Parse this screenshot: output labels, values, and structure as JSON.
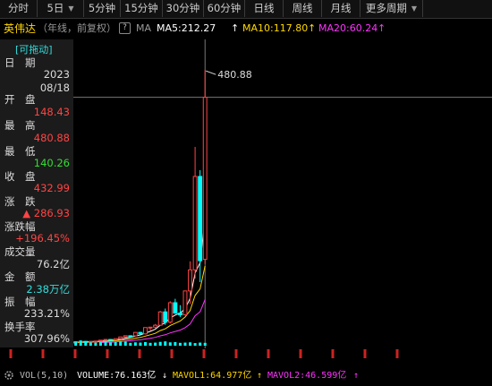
{
  "tabs": [
    {
      "label": "分时",
      "w": 42
    },
    {
      "label": "5日",
      "w": 52,
      "dropdown": true
    },
    {
      "label": "5分钟",
      "w": 41
    },
    {
      "label": "15分钟",
      "w": 47
    },
    {
      "label": "30分钟",
      "w": 46
    },
    {
      "label": "60分钟",
      "w": 46
    },
    {
      "label": "日线",
      "w": 43
    },
    {
      "label": "周线",
      "w": 43
    },
    {
      "label": "月线",
      "w": 43
    },
    {
      "label": "更多周期",
      "w": 70,
      "dropdown": true
    }
  ],
  "header": {
    "stock_name": "英伟达",
    "period_note": "（年线，前复权）",
    "help_icon": "question-icon",
    "ma_label": "MA",
    "ma5": "MA5:212.27",
    "ma10": "MA10:117.80",
    "ma20": "MA20:60.24",
    "up_arrow": "↑",
    "colors": {
      "ma5": "#ffffff",
      "ma10": "#ffd700",
      "ma20": "#ff33ff"
    }
  },
  "info_panel": {
    "drag_label": "[可拖动]",
    "rows": [
      {
        "label": "日　期",
        "value": "2023",
        "value2": "08/18",
        "color": "#dddddd"
      },
      {
        "label": "开　盘",
        "value": "148.43",
        "color": "#ff4444"
      },
      {
        "label": "最　高",
        "value": "480.88",
        "color": "#ff4444"
      },
      {
        "label": "最　低",
        "value": "140.26",
        "color": "#33dd33"
      },
      {
        "label": "收　盘",
        "value": "432.99",
        "color": "#ff4444"
      },
      {
        "label": "涨　跌",
        "value": "▲ 286.93",
        "color": "#ff4444"
      },
      {
        "label": "涨跌幅",
        "value": "+196.45%",
        "color": "#ff4444"
      },
      {
        "label": "成交量",
        "value": "76.2亿",
        "color": "#dddddd"
      },
      {
        "label": "金　额",
        "value": "2.38万亿",
        "color": "#33dddd"
      },
      {
        "label": "振　幅",
        "value": "233.21%",
        "color": "#dddddd"
      },
      {
        "label": "换手率",
        "value": "307.96%",
        "color": "#dddddd"
      }
    ]
  },
  "chart_data": {
    "type": "candlestick",
    "y_range": [
      0,
      500
    ],
    "max_label": "480.88",
    "bullish_color": "#ff4444",
    "bearish_color": "#00ffff",
    "candles": [
      {
        "o": 0.12,
        "h": 0.15,
        "l": 0.08,
        "c": 0.14
      },
      {
        "o": 0.14,
        "h": 0.2,
        "l": 0.12,
        "c": 0.18
      },
      {
        "o": 0.18,
        "h": 0.3,
        "l": 0.16,
        "c": 0.28
      },
      {
        "o": 0.28,
        "h": 0.35,
        "l": 0.2,
        "c": 0.22
      },
      {
        "o": 0.22,
        "h": 0.28,
        "l": 0.18,
        "c": 0.25
      },
      {
        "o": 0.25,
        "h": 0.45,
        "l": 0.24,
        "c": 0.42
      },
      {
        "o": 0.42,
        "h": 0.85,
        "l": 0.4,
        "c": 0.8
      },
      {
        "o": 0.8,
        "h": 1.3,
        "l": 0.75,
        "c": 1.2
      },
      {
        "o": 1.2,
        "h": 1.8,
        "l": 1.1,
        "c": 1.7
      },
      {
        "o": 1.7,
        "h": 2.3,
        "l": 1.6,
        "c": 2.2
      },
      {
        "o": 2.2,
        "h": 2.6,
        "l": 1.9,
        "c": 2.05
      },
      {
        "o": 2.05,
        "h": 2.5,
        "l": 1.8,
        "c": 2.4
      },
      {
        "o": 2.4,
        "h": 2.7,
        "l": 2.1,
        "c": 2.5
      },
      {
        "o": 2.5,
        "h": 3.6,
        "l": 2.4,
        "c": 3.5
      },
      {
        "o": 3.5,
        "h": 4.2,
        "l": 3.2,
        "c": 3.9
      },
      {
        "o": 3.9,
        "h": 4.6,
        "l": 3.7,
        "c": 4.5
      },
      {
        "o": 4.5,
        "h": 4.9,
        "l": 3.9,
        "c": 4.1
      },
      {
        "o": 4.1,
        "h": 4.8,
        "l": 3.6,
        "c": 4.4
      },
      {
        "o": 4.4,
        "h": 5.2,
        "l": 4.2,
        "c": 5.0
      },
      {
        "o": 5.0,
        "h": 6.8,
        "l": 4.8,
        "c": 6.5
      },
      {
        "o": 6.5,
        "h": 8.2,
        "l": 6.2,
        "c": 7.8
      },
      {
        "o": 7.8,
        "h": 8.5,
        "l": 6.3,
        "c": 6.8
      },
      {
        "o": 6.8,
        "h": 9.5,
        "l": 6.6,
        "c": 9.1
      },
      {
        "o": 9.1,
        "h": 12.5,
        "l": 8.9,
        "c": 12.2
      },
      {
        "o": 12.2,
        "h": 14.6,
        "l": 11.6,
        "c": 14.3
      },
      {
        "o": 14.3,
        "h": 15.2,
        "l": 11.5,
        "c": 14.1
      },
      {
        "o": 14.1,
        "h": 20.6,
        "l": 13.9,
        "c": 20.2
      },
      {
        "o": 20.2,
        "h": 21.3,
        "l": 16.2,
        "c": 17.6
      },
      {
        "o": 17.6,
        "h": 29.2,
        "l": 16.9,
        "c": 28.7
      },
      {
        "o": 28.7,
        "h": 29.9,
        "l": 23.5,
        "c": 29.4
      },
      {
        "o": 29.4,
        "h": 35.0,
        "l": 27.2,
        "c": 32.8
      },
      {
        "o": 32.8,
        "h": 58.0,
        "l": 32.0,
        "c": 56.2
      },
      {
        "o": 56.2,
        "h": 62.1,
        "l": 33.5,
        "c": 38.2
      },
      {
        "o": 38.2,
        "h": 75.0,
        "l": 36.0,
        "c": 72.3
      },
      {
        "o": 72.3,
        "h": 79.2,
        "l": 53.0,
        "c": 54.0
      },
      {
        "o": 54.0,
        "h": 68.0,
        "l": 47.0,
        "c": 51.0
      },
      {
        "o": 51.0,
        "h": 93.0,
        "l": 50.0,
        "c": 93.0
      },
      {
        "o": 93.0,
        "h": 145.0,
        "l": 70.0,
        "c": 130.0
      },
      {
        "o": 130.0,
        "h": 346.0,
        "l": 115.0,
        "c": 294.0
      },
      {
        "o": 294.0,
        "h": 305.0,
        "l": 108.5,
        "c": 146.1
      },
      {
        "o": 148.43,
        "h": 480.88,
        "l": 140.26,
        "c": 432.99
      }
    ],
    "volume": [
      8,
      9,
      10,
      7,
      8,
      12,
      22,
      28,
      30,
      25,
      18,
      16,
      14,
      20,
      18,
      22,
      15,
      14,
      13,
      16,
      20,
      14,
      16,
      18,
      17,
      12,
      14,
      13,
      15,
      12,
      13,
      16,
      18,
      14,
      15,
      12,
      13,
      14,
      11,
      13,
      12
    ]
  },
  "vol_bar": {
    "label": "VOL(5,10)",
    "volume": "VOLUME:76.163亿",
    "down_arrow": "↓",
    "mavol1": "MAVOL1:64.977亿",
    "mavol2": "MAVOL2:46.599亿",
    "up_arrow": "↑",
    "colors": {
      "volume": "#ffffff",
      "mavol1": "#ffd700",
      "mavol2": "#ff33ff"
    }
  }
}
